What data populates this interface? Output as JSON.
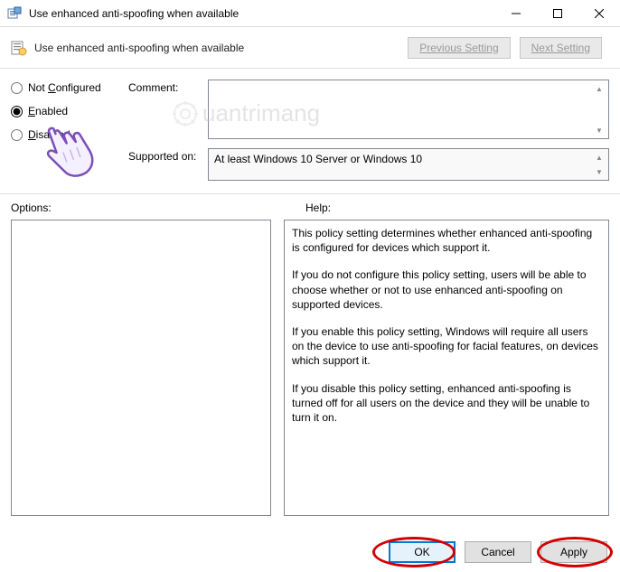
{
  "window": {
    "title": "Use enhanced anti-spoofing when available"
  },
  "header": {
    "policy_title": "Use enhanced anti-spoofing when available",
    "prev_setting": "Previous Setting",
    "next_setting": "Next Setting"
  },
  "radios": {
    "not_configured": "Not Configured",
    "enabled": "Enabled",
    "disabled": "Disabled",
    "selected": "enabled"
  },
  "fields": {
    "comment_label": "Comment:",
    "comment_value": "",
    "supported_label": "Supported on:",
    "supported_value": "At least Windows 10 Server or Windows 10"
  },
  "panels": {
    "options_label": "Options:",
    "help_label": "Help:",
    "help_p1": "This policy setting determines whether enhanced anti-spoofing is configured for devices which support it.",
    "help_p2": "If you do not configure this policy setting, users will be able to choose whether or not to use enhanced anti-spoofing on supported devices.",
    "help_p3": "If you enable this policy setting, Windows will require all users on the device to use anti-spoofing for facial features, on devices which support it.",
    "help_p4": "If you disable this policy setting, enhanced anti-spoofing is turned off for all users on the device and they will be unable to turn it on."
  },
  "footer": {
    "ok": "OK",
    "cancel": "Cancel",
    "apply": "Apply"
  },
  "watermark": {
    "text": "uantrimang"
  }
}
